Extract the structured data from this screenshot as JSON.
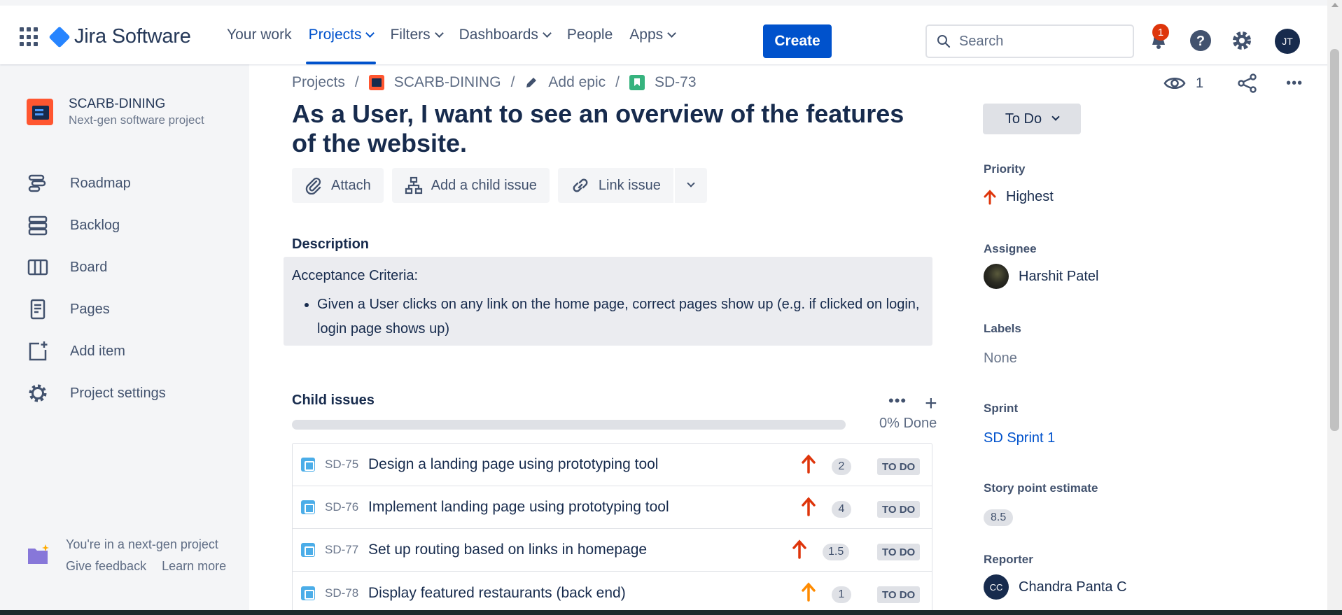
{
  "app": {
    "name": "Jira Software"
  },
  "nav": {
    "items": [
      {
        "label": "Your work",
        "dropdown": false,
        "active": false
      },
      {
        "label": "Projects",
        "dropdown": true,
        "active": true
      },
      {
        "label": "Filters",
        "dropdown": true,
        "active": false
      },
      {
        "label": "Dashboards",
        "dropdown": true,
        "active": false
      },
      {
        "label": "People",
        "dropdown": false,
        "active": false
      },
      {
        "label": "Apps",
        "dropdown": true,
        "active": false
      }
    ],
    "create_label": "Create",
    "search_placeholder": "Search",
    "notification_count": "1",
    "user_initials": "JT",
    "icons": [
      "app-switcher-icon",
      "notifications-icon",
      "help-icon",
      "settings-icon"
    ]
  },
  "sidebar": {
    "project_name": "SCARB-DINING",
    "project_type": "Next-gen software project",
    "items": [
      {
        "label": "Roadmap",
        "icon": "roadmap-icon"
      },
      {
        "label": "Backlog",
        "icon": "backlog-icon"
      },
      {
        "label": "Board",
        "icon": "board-icon"
      },
      {
        "label": "Pages",
        "icon": "pages-icon"
      },
      {
        "label": "Add item",
        "icon": "add-item-icon"
      },
      {
        "label": "Project settings",
        "icon": "settings-icon"
      }
    ],
    "footer": {
      "text": "You're in a next-gen project",
      "feedback": "Give feedback",
      "learn_more": "Learn more"
    }
  },
  "breadcrumb": {
    "projects": "Projects",
    "project": "SCARB-DINING",
    "epic": "Add epic",
    "issue_key": "SD-73"
  },
  "issue": {
    "title": "As a User, I want to see an overview of the features of the website.",
    "actions": {
      "attach": "Attach",
      "add_child": "Add a child issue",
      "link": "Link issue"
    },
    "description_label": "Description",
    "description_heading": "Acceptance Criteria:",
    "description_bullets": [
      "Given a User clicks on any link on the home page, correct pages show up (e.g. if clicked on login, login page shows up)"
    ]
  },
  "child_issues": {
    "label": "Child issues",
    "progress_text": "0% Done",
    "progress": 0,
    "items": [
      {
        "key": "SD-75",
        "summary": "Design a landing page using prototyping tool",
        "priority_color": "#DE350B",
        "points": "2",
        "status": "TO DO"
      },
      {
        "key": "SD-76",
        "summary": "Implement landing page using prototyping tool",
        "priority_color": "#DE350B",
        "points": "4",
        "status": "TO DO"
      },
      {
        "key": "SD-77",
        "summary": "Set up routing based on links in homepage",
        "priority_color": "#DE350B",
        "points": "1.5",
        "status": "TO DO"
      },
      {
        "key": "SD-78",
        "summary": "Display featured restaurants (back end)",
        "priority_color": "#FF8B00",
        "points": "1",
        "status": "TO DO"
      }
    ]
  },
  "details": {
    "watchers": "1",
    "status": "To Do",
    "priority_label": "Priority",
    "priority": "Highest",
    "assignee_label": "Assignee",
    "assignee": "Harshit Patel",
    "labels_label": "Labels",
    "labels": "None",
    "sprint_label": "Sprint",
    "sprint": "SD Sprint 1",
    "story_points_label": "Story point estimate",
    "story_points": "8.5",
    "reporter_label": "Reporter",
    "reporter": "Chandra Panta C",
    "reporter_initials": "CC"
  },
  "colors": {
    "primary": "#0052CC",
    "text": "#172B4D",
    "highest_priority": "#DE350B",
    "high_priority": "#FF8B00",
    "subtask": "#4BADE8",
    "story": "#36B37E"
  }
}
